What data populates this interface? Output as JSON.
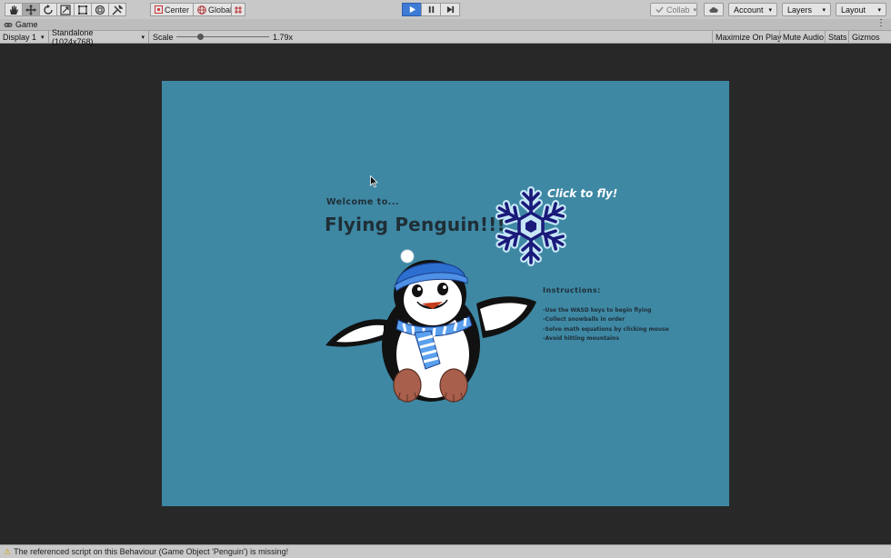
{
  "toolbar": {
    "tools": [
      {
        "icon": "hand-tool-icon"
      },
      {
        "icon": "move-tool-icon"
      },
      {
        "icon": "rotate-tool-icon"
      },
      {
        "icon": "scale-tool-icon"
      },
      {
        "icon": "rect-tool-icon"
      },
      {
        "icon": "transform-tool-icon"
      },
      {
        "icon": "custom-tool-icon"
      }
    ],
    "pivot_mode": "Center",
    "pivot_rotation": "Global",
    "collab": "Collab",
    "account": "Account",
    "layers": "Layers",
    "layout": "Layout"
  },
  "tab": {
    "label": "Game"
  },
  "gamebar": {
    "display": "Display 1",
    "resolution": "Standalone (1024x768)",
    "scale_label": "Scale",
    "scale_value": "1.79x",
    "maximize": "Maximize On Play",
    "mute": "Mute Audio",
    "stats": "Stats",
    "gizmos": "Gizmos"
  },
  "game": {
    "welcome": "Welcome to...",
    "title": "Flying Penguin!!!",
    "click_to_fly": "Click to fly!",
    "instructions_heading": "Instructions:",
    "instructions": [
      "-Use the WASD keys to begin flying",
      "-Collect snowballs in order",
      "-Solve math equations by clicking mouse",
      "-Avoid hitting mountains"
    ],
    "colors": {
      "background": "#3e88a4",
      "snowflake": "#1a1a7a",
      "hat": "#2d6fd1",
      "beak": "#ef6a1c"
    }
  },
  "status": {
    "message": "The referenced script on this Behaviour (Game Object 'Penguin') is missing!"
  }
}
